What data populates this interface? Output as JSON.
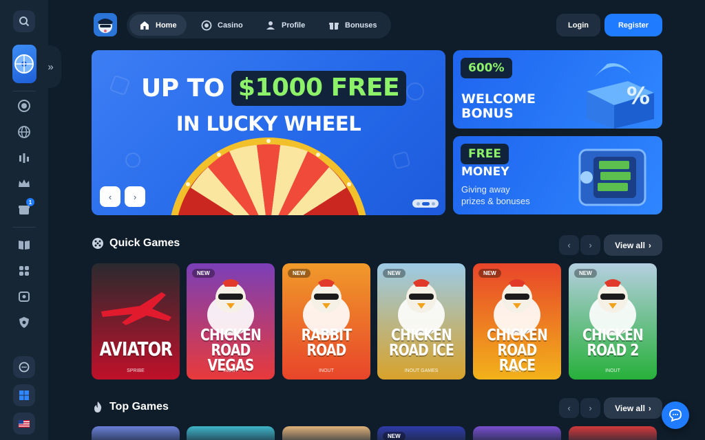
{
  "nav": {
    "items": [
      {
        "label": "Home",
        "icon": "home-icon",
        "active": true
      },
      {
        "label": "Casino",
        "icon": "casino-chip-icon",
        "active": false
      },
      {
        "label": "Profile",
        "icon": "user-icon",
        "active": false
      },
      {
        "label": "Bonuses",
        "icon": "gift-icon",
        "active": false
      }
    ],
    "login": "Login",
    "register": "Register"
  },
  "sidebar": {
    "gift_count": "1",
    "icons": [
      "search-icon",
      "casino-chip-icon",
      "globe-icon",
      "chart-icon",
      "crown-icon",
      "gift-icon",
      "book-icon",
      "game-controller-icon",
      "safe-icon",
      "shield-icon",
      "support-icon",
      "windows-icon",
      "us-flag-icon"
    ]
  },
  "hero": {
    "line1_prefix": "UP TO",
    "line1_highlight": "$1000 FREE",
    "line2": "IN LUCKY WHEEL",
    "prev": "‹",
    "next": "›"
  },
  "promo_cards": [
    {
      "badge": "600%",
      "title_line1": "WELCOME",
      "title_line2": "BONUS"
    },
    {
      "badge": "FREE",
      "title": "MONEY",
      "subtitle_line1": "Giving away",
      "subtitle_line2": "prizes & bonuses"
    }
  ],
  "quick_games": {
    "title": "Quick Games",
    "view_all": "View all",
    "games": [
      {
        "title_line1": "AVIATOR",
        "title_line2": "",
        "provider": "SPRIBE",
        "new": "",
        "color_top": "#2a2a2e",
        "color_bottom": "#c0102a"
      },
      {
        "title_line1": "CHICKEN",
        "title_line2": "ROAD VEGAS",
        "provider": "INOUT",
        "new": "NEW",
        "color_top": "#7a3fb8",
        "color_bottom": "#e83a3a"
      },
      {
        "title_line1": "RABBIT",
        "title_line2": "ROAD",
        "provider": "INOUT",
        "new": "NEW",
        "color_top": "#f09a2a",
        "color_bottom": "#e8452a"
      },
      {
        "title_line1": "CHICKEN",
        "title_line2": "ROAD ICE",
        "provider": "INOUT GAMES",
        "new": "NEW",
        "color_top": "#9ccbe6",
        "color_bottom": "#d8a22a"
      },
      {
        "title_line1": "CHICKEN",
        "title_line2": "ROAD RACE",
        "provider": "INOUT",
        "new": "NEW",
        "color_top": "#e8452a",
        "color_bottom": "#f2b21a"
      },
      {
        "title_line1": "CHICKEN",
        "title_line2": "ROAD 2",
        "provider": "INOUT",
        "new": "NEW",
        "color_top": "#b5cfe0",
        "color_bottom": "#27b03a"
      }
    ]
  },
  "top_games": {
    "title": "Top Games",
    "view_all": "View all",
    "new_label": "NEW",
    "colors": [
      "#6a7fd8",
      "#3fb6c9",
      "#e0b27a",
      "#2f3ba8",
      "#7a4fd0",
      "#d23a3a"
    ]
  }
}
